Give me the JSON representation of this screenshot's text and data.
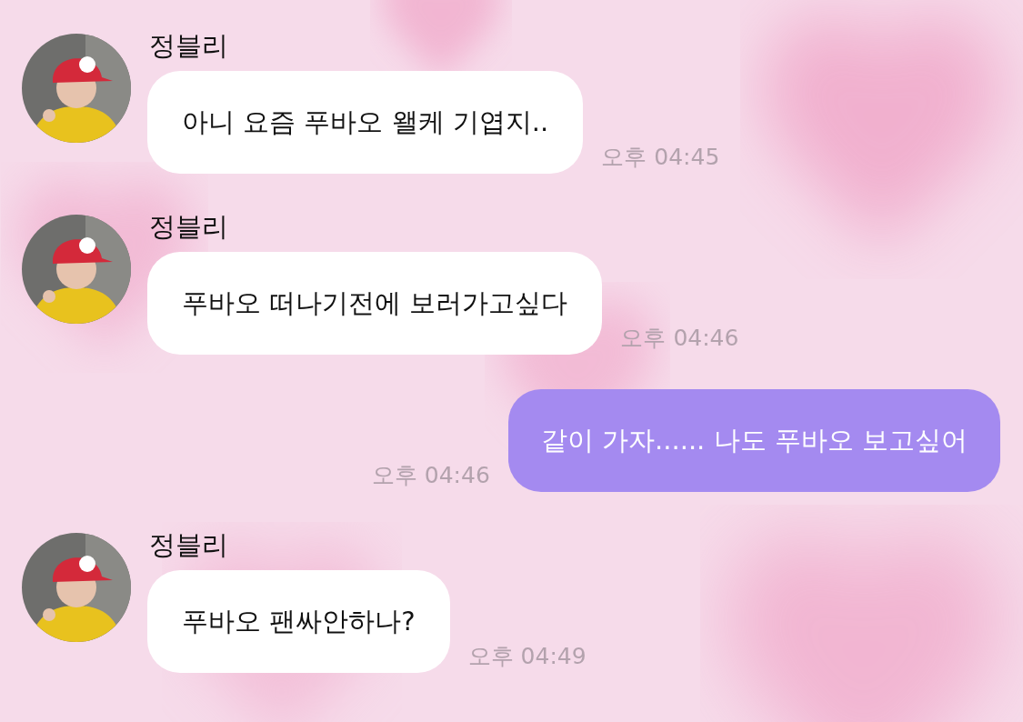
{
  "messages": [
    {
      "kind": "incoming",
      "sender": "정블리",
      "text": "아니 요즘 푸바오 왤케 기엽지..",
      "time": "오후 04:45"
    },
    {
      "kind": "incoming",
      "sender": "정블리",
      "text": "푸바오 떠나기전에 보러가고싶다",
      "time": "오후 04:46"
    },
    {
      "kind": "outgoing",
      "text": "같이 가자...... 나도 푸바오 보고싶어",
      "time": "오후 04:46"
    },
    {
      "kind": "incoming",
      "sender": "정블리",
      "text": "푸바오 팬싸안하나?",
      "time": "오후 04:49"
    }
  ]
}
